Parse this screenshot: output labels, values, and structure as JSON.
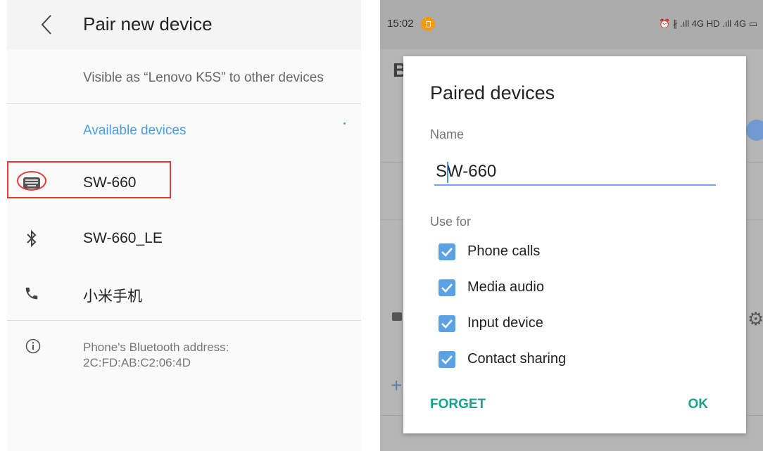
{
  "left": {
    "title": "Pair new device",
    "visible_text": "Visible as “Lenovo K5S” to other devices",
    "section_label": "Available devices",
    "devices": [
      {
        "label": "SW-660",
        "icon": "keyboard-icon"
      },
      {
        "label": "SW-660_LE",
        "icon": "bluetooth-icon"
      },
      {
        "label": "小米手机",
        "icon": "phone-icon"
      }
    ],
    "address_label": "Phone's Bluetooth address:",
    "address_value": "2C:FD:AB:C2:06:4D"
  },
  "right": {
    "status": {
      "time": "15:02",
      "icons": "⏰ ∦ .ıll 4G HD .ıll 4G ▭"
    },
    "background_letter": "B",
    "dialog": {
      "title": "Paired devices",
      "name_label": "Name",
      "name_value": "SW-660",
      "use_for_label": "Use for",
      "options": [
        {
          "label": "Phone calls",
          "checked": true
        },
        {
          "label": "Media audio",
          "checked": true
        },
        {
          "label": "Input device",
          "checked": true
        },
        {
          "label": "Contact sharing",
          "checked": true
        }
      ],
      "forget_label": "FORGET",
      "ok_label": "OK"
    }
  },
  "colors": {
    "accent_blue": "#4a9de4",
    "teal": "#19a28f",
    "highlight_red": "#e53935"
  }
}
